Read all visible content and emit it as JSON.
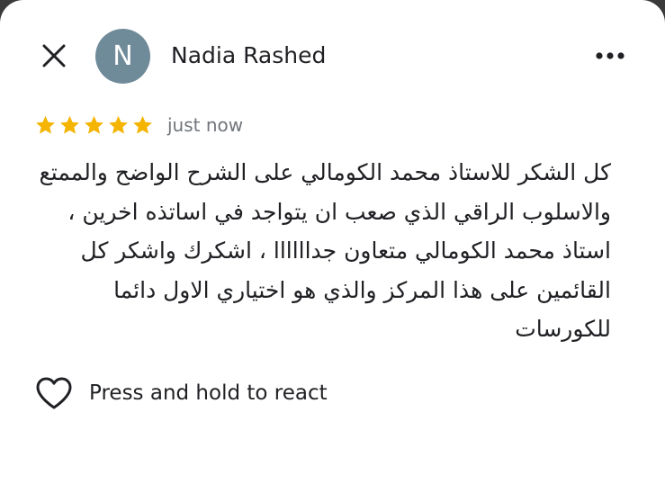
{
  "review": {
    "reviewer_name": "Nadia Rashed",
    "avatar_letter": "N",
    "rating": 5,
    "rating_max": 5,
    "timestamp": "just now",
    "text": "كل الشكر للاستاذ محمد الكومالي على الشرح الواضح والممتع والاسلوب الراقي الذي صعب ان يتواجد في اساتذه اخرين ، استاذ محمد الكومالي متعاون جداااااا ، اشكرك واشكر كل القائمين على هذا المركز والذي هو اختياري الاول دائما للكورسات"
  },
  "actions": {
    "react_label": "Press and hold to react"
  },
  "icons": {
    "close": "close-icon",
    "more": "more-vertical-dots-icon",
    "star": "star-icon",
    "heart": "heart-outline-icon"
  },
  "colors": {
    "star": "#f4b400",
    "avatar_bg": "#6f8a99",
    "text_primary": "#202124",
    "text_secondary": "#70757a"
  }
}
